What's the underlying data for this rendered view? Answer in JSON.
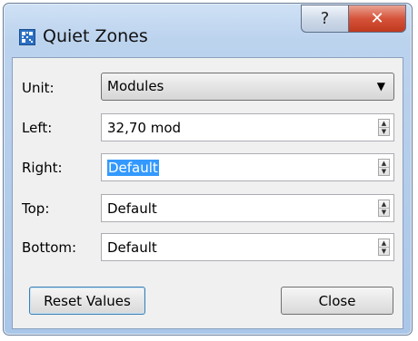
{
  "window": {
    "title": "Quiet Zones",
    "help_glyph": "?",
    "close_glyph": "✕"
  },
  "form": {
    "unit": {
      "label": "Unit:",
      "value": "Modules"
    },
    "left": {
      "label": "Left:",
      "value": "32,70 mod"
    },
    "right": {
      "label": "Right:",
      "value": "Default"
    },
    "top": {
      "label": "Top:",
      "value": "Default"
    },
    "bottom": {
      "label": "Bottom:",
      "value": "Default"
    }
  },
  "buttons": {
    "reset": "Reset Values",
    "close": "Close"
  },
  "icons": {
    "app": "qr-code-icon",
    "dropdown": "chevron-down-icon",
    "spin_up": "spin-up-icon",
    "spin_down": "spin-down-icon"
  },
  "colors": {
    "selection": "#3399ff",
    "close_button": "#d6533a",
    "title_bar": "#bcd3ee"
  }
}
